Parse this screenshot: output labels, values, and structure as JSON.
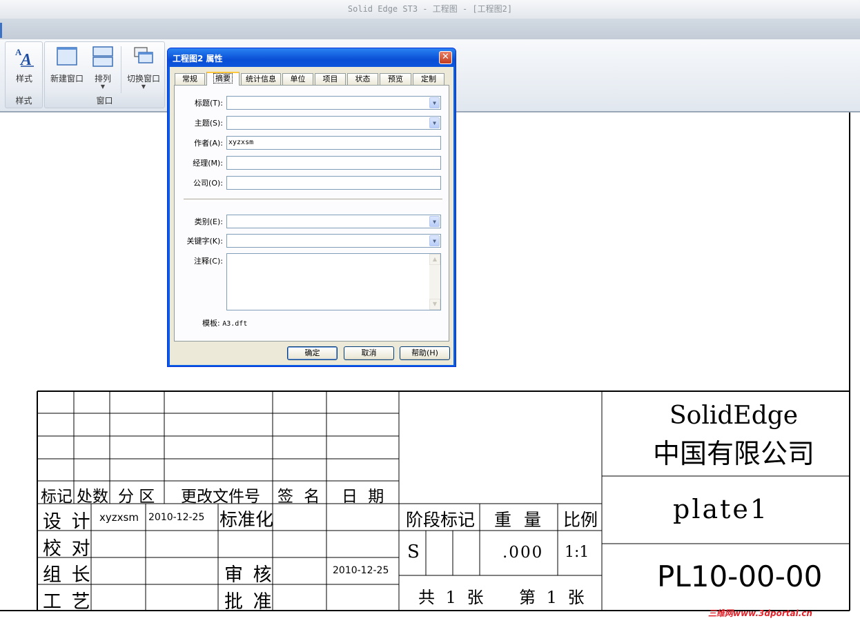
{
  "window": {
    "title": "Solid Edge ST3 - 工程图 - [工程图2]"
  },
  "ribbon": {
    "style_group": {
      "label": "样式",
      "style_button": "样式"
    },
    "window_group": {
      "label": "窗口",
      "new_window": "新建窗口",
      "arrange": "排列",
      "switch_window": "切换窗口"
    }
  },
  "dialog": {
    "title": "工程图2 属性",
    "tabs": [
      "常规",
      "摘要",
      "统计信息",
      "单位",
      "项目",
      "状态",
      "预览",
      "定制"
    ],
    "active_tab": "摘要",
    "fields": {
      "title": {
        "label": "标题(T):",
        "value": ""
      },
      "subject": {
        "label": "主题(S):",
        "value": ""
      },
      "author": {
        "label": "作者(A):",
        "value": "xyzxsm"
      },
      "manager": {
        "label": "经理(M):",
        "value": ""
      },
      "company": {
        "label": "公司(O):",
        "value": ""
      },
      "category": {
        "label": "类别(E):",
        "value": ""
      },
      "keywords": {
        "label": "关键字(K):",
        "value": ""
      },
      "comments": {
        "label": "注释(C):",
        "value": ""
      }
    },
    "template": {
      "label": "模板:",
      "value": "A3.dft"
    },
    "buttons": {
      "ok": "确定",
      "cancel": "取消",
      "help": "帮助(H)"
    }
  },
  "title_block": {
    "revision_headers": [
      "标记",
      "处数",
      "分 区",
      "更改文件号",
      "签 名",
      "日 期"
    ],
    "design_label": "设 计",
    "designer": "xyzxsm",
    "design_date": "2010-12-25",
    "standardization_label": "标准化",
    "check_label": "校 对",
    "team_lead_label": "组 长",
    "review_label": "审 核",
    "review_date": "2010-12-25",
    "process_label": "工 艺",
    "approve_label": "批 准",
    "stage_mark_label": "阶段标记",
    "weight_label": "重 量",
    "scale_label": "比例",
    "stage_value": "S",
    "weight_value": ".000",
    "scale_value": "1:1",
    "total_sheets": "共 1 张",
    "sheet_number": "第 1 张",
    "company_line1": "SolidEdge",
    "company_line2": "中国有限公司",
    "part_name": "plate1",
    "drawing_number": "PL10-00-00"
  },
  "watermark": "三维网www.3dportal.cn"
}
